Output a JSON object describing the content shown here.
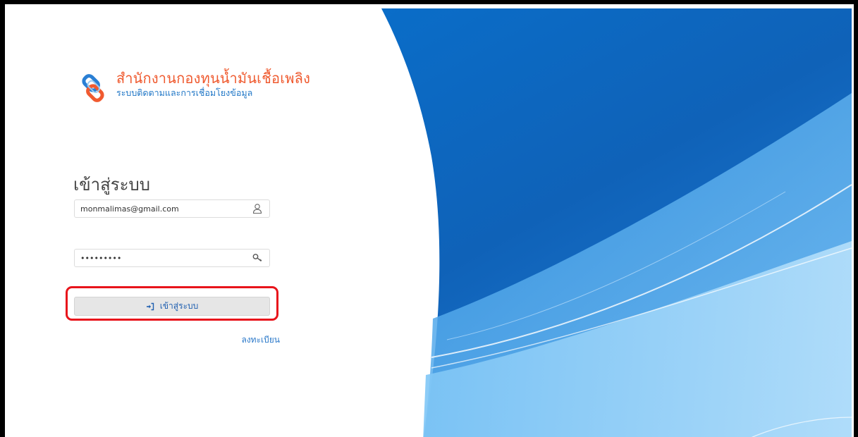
{
  "logo": {
    "title": "สำนักงานกองทุนน้ำมันเชื้อเพลิง",
    "subtitle": "ระบบติดตามและการเชื่อมโยงข้อมูล",
    "icon": "chain-link-logo"
  },
  "login": {
    "heading": "เข้าสู่ระบบ",
    "email_value": "monmalimas@gmail.com",
    "password_value": "•••••••••",
    "button_label": "เข้าสู่ระบบ",
    "register_label": "ลงทะเบียน"
  },
  "icons": {
    "user": "user-icon",
    "key": "key-icon",
    "login": "sign-in-icon"
  },
  "colors": {
    "brand_orange": "#ef5a2f",
    "brand_blue": "#1f76c6",
    "highlight_red": "#e8141b"
  }
}
